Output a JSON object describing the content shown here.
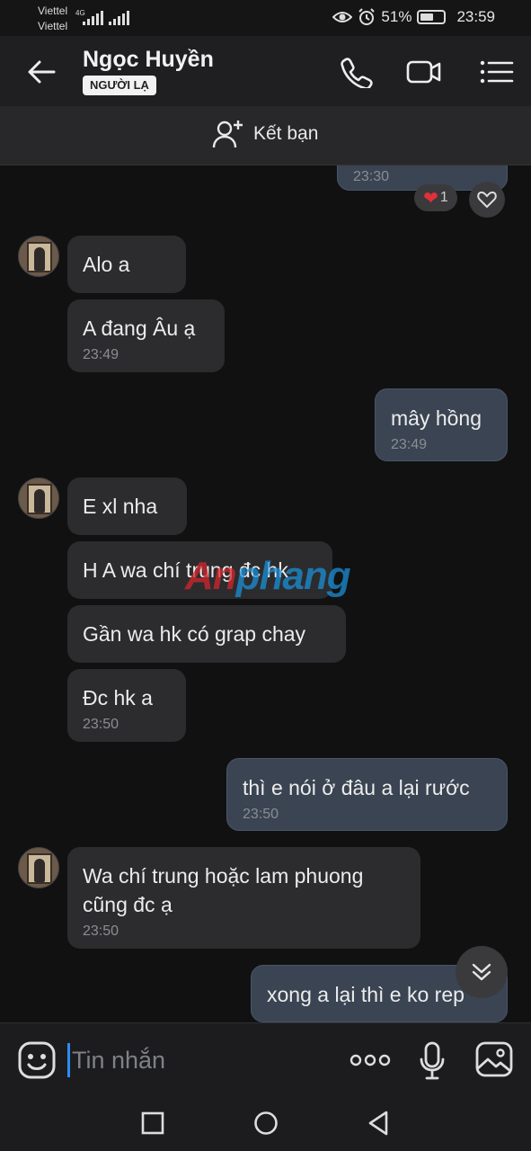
{
  "status_bar": {
    "carrier_1": "Viettel",
    "carrier_2": "Viettel",
    "network": "4G",
    "battery": "51%",
    "time": "23:59"
  },
  "header": {
    "name": "Ngọc Huyền",
    "badge": "NGƯỜI LẠ",
    "icons": [
      "back-arrow-icon",
      "phone-icon",
      "video-icon",
      "menu-list-icon"
    ]
  },
  "friend_bar": {
    "label": "Kết bạn",
    "icon": "add-friend-icon"
  },
  "messages": [
    {
      "dir": "out",
      "text": "",
      "time": "23:30",
      "reaction_count": "1"
    },
    {
      "dir": "in",
      "text": "Alo a",
      "time": ""
    },
    {
      "dir": "in",
      "text": "A đang Âu ạ",
      "time": "23:49"
    },
    {
      "dir": "out",
      "text": "mây hồng",
      "time": "23:49"
    },
    {
      "dir": "in",
      "text": "E xl nha",
      "time": ""
    },
    {
      "dir": "in",
      "text": "H A wa chí trung đc hk",
      "time": ""
    },
    {
      "dir": "in",
      "text": "Gần wa hk có grap chay",
      "time": ""
    },
    {
      "dir": "in",
      "text": "Đc hk a",
      "time": "23:50"
    },
    {
      "dir": "out",
      "text": "thì e nói ở đâu a lại rước",
      "time": "23:50"
    },
    {
      "dir": "in",
      "text_line_1": "Wa chí trung hoặc lam phuong",
      "text_line_2": "cũng đc  ạ",
      "time": "23:50"
    },
    {
      "dir": "out",
      "text": "xong a lại thì e ko rep",
      "time": ""
    }
  ],
  "watermark": {
    "part_a": "An",
    "part_b": "phang"
  },
  "input_bar": {
    "placeholder": "Tin nhắn",
    "icons": [
      "emoji-icon",
      "more-dots-icon",
      "microphone-icon",
      "image-icon"
    ]
  },
  "nav_bar": {
    "icons": [
      "recent-apps-icon",
      "home-icon",
      "back-icon"
    ]
  },
  "colors": {
    "background": "#111112",
    "incoming": "#2c2c2e",
    "outgoing": "#3a4452",
    "caret": "#2f8cf0",
    "heart": "#e0303a"
  }
}
